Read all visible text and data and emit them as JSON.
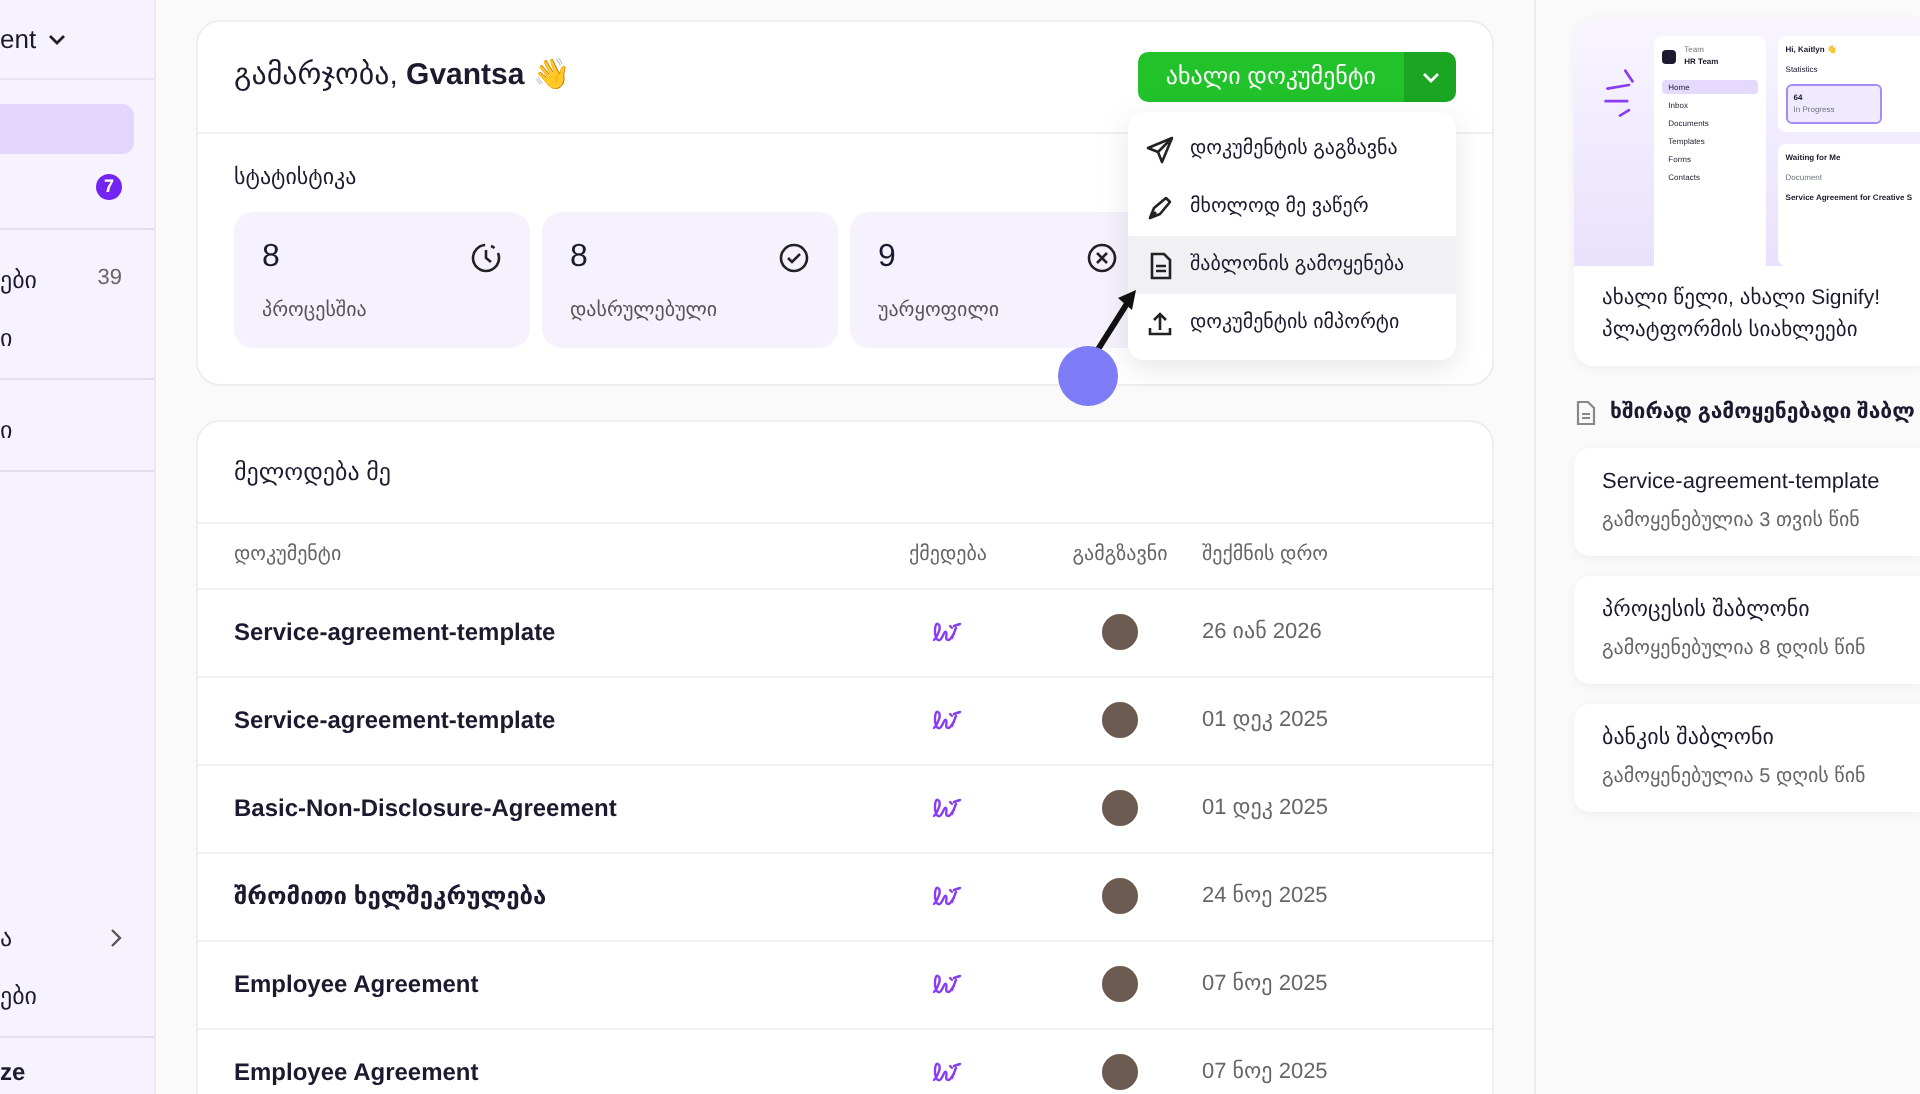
{
  "sidebar": {
    "workspace_label": "ent",
    "groups": [
      [
        {
          "selected": true
        },
        {
          "selected": false,
          "badge": "7"
        }
      ],
      [
        {
          "selected": false,
          "label": "ები",
          "count": "39"
        },
        {
          "selected": false,
          "label": "ი"
        }
      ],
      [
        {
          "selected": false,
          "label": "ი"
        }
      ]
    ],
    "bottom_items": [
      {
        "selected": false,
        "label": "ა",
        "expandable": true
      },
      {
        "selected": false,
        "label": "ები",
        "expandable": false
      }
    ],
    "footer_label": "ze"
  },
  "welcome": {
    "greeting": "გამარჯობა, **Gvantsa** 👋",
    "new_button": "ახალი დოკუმენტი",
    "menu": {
      "open": true,
      "items": [
        {
          "kind": "send",
          "label": "დოკუმენტის გაგზავნა",
          "selected": false
        },
        {
          "kind": "sign",
          "label": "მხოლოდ მე ვაწერ",
          "selected": false
        },
        {
          "kind": "template",
          "label": "შაბლონის გამოყენება",
          "selected": true
        },
        {
          "kind": "import",
          "label": "დოკუმენტის იმპორტი",
          "selected": false
        }
      ]
    },
    "stats_title": "სტატისტიკა",
    "stats": [
      {
        "kind": "in_progress",
        "value": "8",
        "label": "პროცესშია"
      },
      {
        "kind": "completed",
        "value": "8",
        "label": "დასრულებული"
      },
      {
        "kind": "rejected",
        "value": "9",
        "label": "უარყოფილი"
      }
    ]
  },
  "waiting": {
    "title": "მელოდება მე",
    "columns": [
      "დოკუმენტი",
      "ქმედება",
      "გამგზავნი",
      "შექმნის დრო"
    ],
    "rows": [
      {
        "document": "Service-agreement-template",
        "date": "26 იან 2026"
      },
      {
        "document": "Service-agreement-template",
        "date": "01 დეკ 2025"
      },
      {
        "document": "Basic-Non-Disclosure-Agreement",
        "date": "01 დეკ 2025"
      },
      {
        "document": "შრომითი ხელშეკრულება",
        "date": "24 ნოე 2025"
      },
      {
        "document": "Employee Agreement",
        "date": "07 ნოე 2025"
      },
      {
        "document": "Employee Agreement",
        "date": "07 ნოე 2025"
      }
    ]
  },
  "promo": {
    "mockup": {
      "team_label": "Team",
      "team_name": "HR Team",
      "nav": [
        {
          "label": "Home",
          "selected": true
        },
        {
          "label": "Inbox",
          "selected": false
        },
        {
          "label": "Documents",
          "selected": false
        },
        {
          "label": "Templates",
          "selected": false
        },
        {
          "label": "Forms",
          "selected": false
        },
        {
          "label": "Contacts",
          "selected": false
        }
      ],
      "greeting": "Hi, Kaitlyn 👋",
      "stats_title": "Statistics",
      "stat_value": "64",
      "stat_label": "In Progress",
      "waiting_title": "Waiting for Me",
      "column": "Document",
      "row": "Service Agreement for Creative S"
    },
    "title_lines": [
      "ახალი წელი, ახალი Signify!",
      "პლატფორმის სიახლეები"
    ]
  },
  "templates": {
    "title": "ხშირად გამოყენებადი შაბლ",
    "items": [
      {
        "name": "Service-agreement-template",
        "used": "გამოყენებულია 3 თვის წინ"
      },
      {
        "name": "პროცესის შაბლონი",
        "used": "გამოყენებულია 8 დღის წინ"
      },
      {
        "name": "ბანკის შაბლონი",
        "used": "გამოყენებულია 5 დღის წინ"
      }
    ]
  }
}
